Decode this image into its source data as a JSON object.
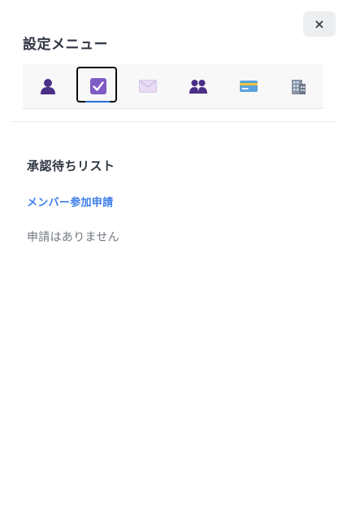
{
  "close": {
    "label": "×"
  },
  "menu": {
    "title": "設定メニュー",
    "tabs": [
      {
        "icon": "user-icon",
        "active": false
      },
      {
        "icon": "checkbox-icon",
        "active": true
      },
      {
        "icon": "envelope-icon",
        "active": false
      },
      {
        "icon": "group-icon",
        "active": false
      },
      {
        "icon": "credit-card-icon",
        "active": false
      },
      {
        "icon": "building-icon",
        "active": false
      }
    ]
  },
  "pending": {
    "title": "承認待ちリスト",
    "link_label": "メンバー参加申請",
    "empty_message": "申請はありません"
  },
  "colors": {
    "accent": "#3d7ee8",
    "icon_purple": "#5a3d96",
    "active_underline": "#2a6fd6"
  }
}
